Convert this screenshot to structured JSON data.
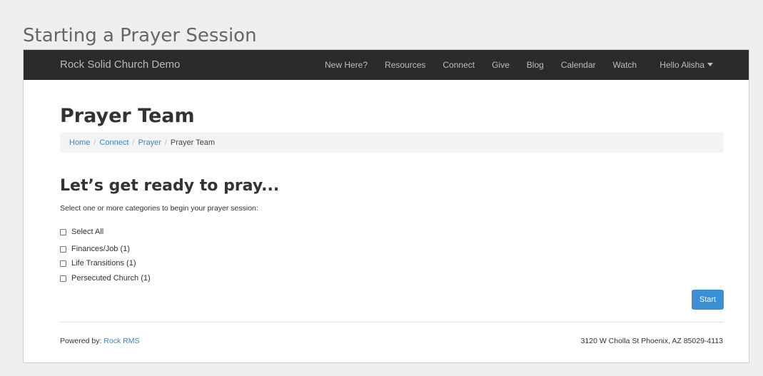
{
  "frame_title": "Starting a Prayer Session",
  "navbar": {
    "brand": "Rock Solid Church Demo",
    "items": [
      "New Here?",
      "Resources",
      "Connect",
      "Give",
      "Blog",
      "Calendar",
      "Watch"
    ],
    "user_menu": "Hello Alisha"
  },
  "page": {
    "title": "Prayer Team",
    "breadcrumb": [
      "Home",
      "Connect",
      "Prayer"
    ],
    "breadcrumb_current": "Prayer Team"
  },
  "prayer": {
    "heading": "Let’s get ready to pray...",
    "instructions": "Select one or more categories to begin your prayer session:",
    "select_all": "Select All",
    "categories": [
      "Finances/Job (1)",
      "Life Transitions (1)",
      "Persecuted Church (1)"
    ],
    "start_label": "Start"
  },
  "footer": {
    "powered_by_label": "Powered by:",
    "powered_by_link": "Rock RMS",
    "address": "3120 W Cholla St Phoenix, AZ 85029-4113"
  }
}
